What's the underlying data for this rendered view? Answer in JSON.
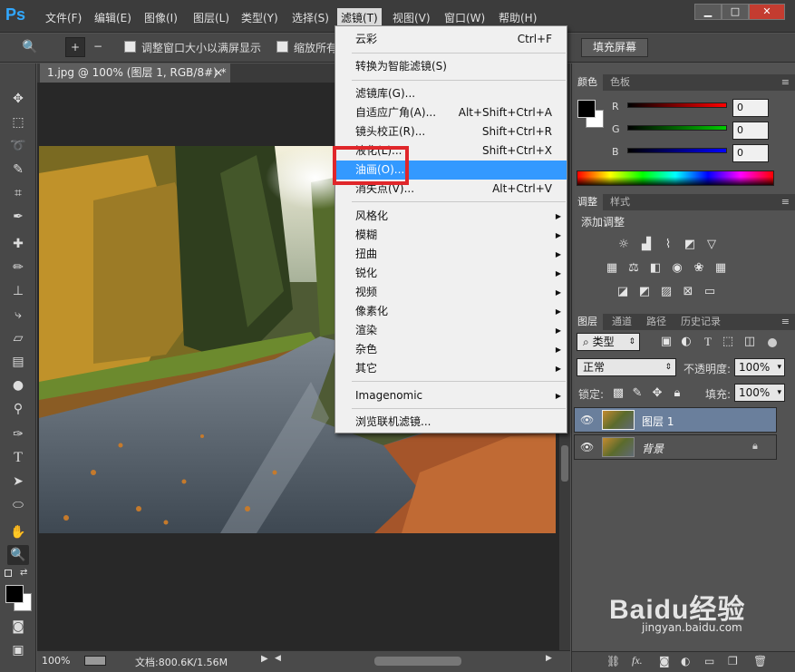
{
  "app": {
    "logo": "Ps"
  },
  "menubar": {
    "items": [
      "文件(F)",
      "编辑(E)",
      "图像(I)",
      "图层(L)",
      "类型(Y)",
      "选择(S)",
      "滤镜(T)",
      "视图(V)",
      "窗口(W)",
      "帮助(H)"
    ],
    "active": "滤镜(T)"
  },
  "window_controls": {
    "minimize": "▁",
    "maximize": "□",
    "close": "✕"
  },
  "options_bar": {
    "resize_windows_label": "调整窗口大小以满屏显示",
    "zoom_all_label": "缩放所有",
    "fill_screen_label": "填充屏幕"
  },
  "document": {
    "tab_title": "1.jpg @ 100% (图层 1, RGB/8#) *",
    "tab_close": "×"
  },
  "status": {
    "zoom": "100%",
    "doc_info": "文档:800.6K/1.56M"
  },
  "filter_menu": {
    "items": [
      {
        "label": "云彩",
        "shortcut": "Ctrl+F"
      },
      {
        "label": "转换为智能滤镜(S)",
        "shortcut": ""
      },
      {
        "label": "滤镜库(G)...",
        "shortcut": ""
      },
      {
        "label": "自适应广角(A)...",
        "shortcut": "Alt+Shift+Ctrl+A"
      },
      {
        "label": "镜头校正(R)...",
        "shortcut": "Shift+Ctrl+R"
      },
      {
        "label": "液化(L)...",
        "shortcut": "Shift+Ctrl+X"
      },
      {
        "label": "油画(O)...",
        "shortcut": "",
        "highlighted": true
      },
      {
        "label": "消失点(V)...",
        "shortcut": "Alt+Ctrl+V"
      },
      {
        "label": "风格化",
        "submenu": true
      },
      {
        "label": "模糊",
        "submenu": true
      },
      {
        "label": "扭曲",
        "submenu": true
      },
      {
        "label": "锐化",
        "submenu": true
      },
      {
        "label": "视频",
        "submenu": true
      },
      {
        "label": "像素化",
        "submenu": true
      },
      {
        "label": "渲染",
        "submenu": true
      },
      {
        "label": "杂色",
        "submenu": true
      },
      {
        "label": "其它",
        "submenu": true
      },
      {
        "label": "Imagenomic",
        "submenu": true
      },
      {
        "label": "浏览联机滤镜...",
        "shortcut": ""
      }
    ]
  },
  "color_panel": {
    "tabs": [
      "颜色",
      "色板"
    ],
    "channels": [
      {
        "label": "R",
        "value": "0",
        "color": "#ff0000"
      },
      {
        "label": "G",
        "value": "0",
        "color": "#00cc00"
      },
      {
        "label": "B",
        "value": "0",
        "color": "#0000ff"
      }
    ]
  },
  "adjust_panel": {
    "tabs": [
      "调整",
      "样式"
    ],
    "heading": "添加调整"
  },
  "layers_panel": {
    "tabs": [
      "图层",
      "通道",
      "路径",
      "历史记录"
    ],
    "filter_kind": "类型",
    "blend_mode": "正常",
    "opacity_label": "不透明度:",
    "opacity_value": "100%",
    "lock_label": "锁定:",
    "fill_label": "填充:",
    "fill_value": "100%",
    "layers": [
      {
        "name": "图层 1",
        "selected": true
      },
      {
        "name": "背景",
        "locked": true
      }
    ],
    "footer_fx": "fx."
  },
  "watermark": {
    "brand": "Baidu经验",
    "url": "jingyan.baidu.com"
  },
  "colors": {
    "menu_highlight": "#3399ff",
    "annotation_box": "#e0262a",
    "accent": "#31a8ff"
  }
}
